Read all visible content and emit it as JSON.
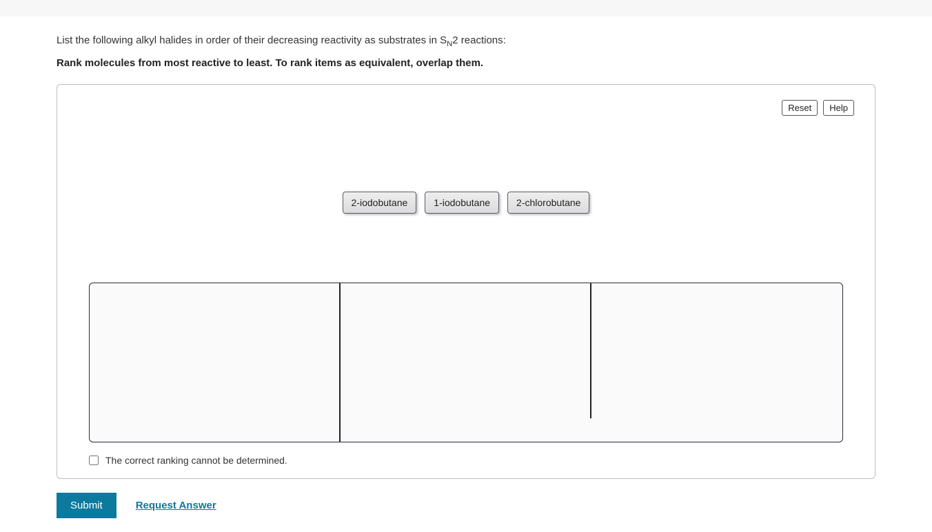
{
  "prompt": {
    "prefix": "List the following alkyl halides in order of their decreasing reactivity as substrates in S",
    "sub": "N",
    "suffix": "2 reactions:"
  },
  "instruction": "Rank molecules from most reactive to least. To rank items as equivalent, overlap them.",
  "controls": {
    "reset": "Reset",
    "help": "Help"
  },
  "chips": [
    "2-iodobutane",
    "1-iodobutane",
    "2-chlorobutane"
  ],
  "checkbox_label": "The correct ranking cannot be determined.",
  "actions": {
    "submit": "Submit",
    "request": "Request Answer"
  }
}
